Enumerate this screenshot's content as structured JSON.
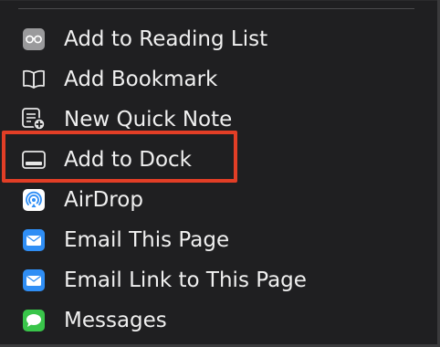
{
  "menu": {
    "items": [
      {
        "label": "Add to Reading List",
        "icon": "reading-list-icon"
      },
      {
        "label": "Add Bookmark",
        "icon": "bookmark-icon"
      },
      {
        "label": "New Quick Note",
        "icon": "quick-note-icon"
      },
      {
        "label": "Add to Dock",
        "icon": "dock-icon"
      },
      {
        "label": "AirDrop",
        "icon": "airdrop-icon"
      },
      {
        "label": "Email This Page",
        "icon": "mail-icon"
      },
      {
        "label": "Email Link to This Page",
        "icon": "mail-icon"
      },
      {
        "label": "Messages",
        "icon": "messages-icon"
      }
    ]
  },
  "highlight": {
    "target": "Add to Dock",
    "color": "#e23e26"
  },
  "colors": {
    "background": "#1f1f21",
    "text": "#f0f0f0",
    "mail_blue": "#2f8ef5",
    "messages_green": "#39c54a"
  }
}
